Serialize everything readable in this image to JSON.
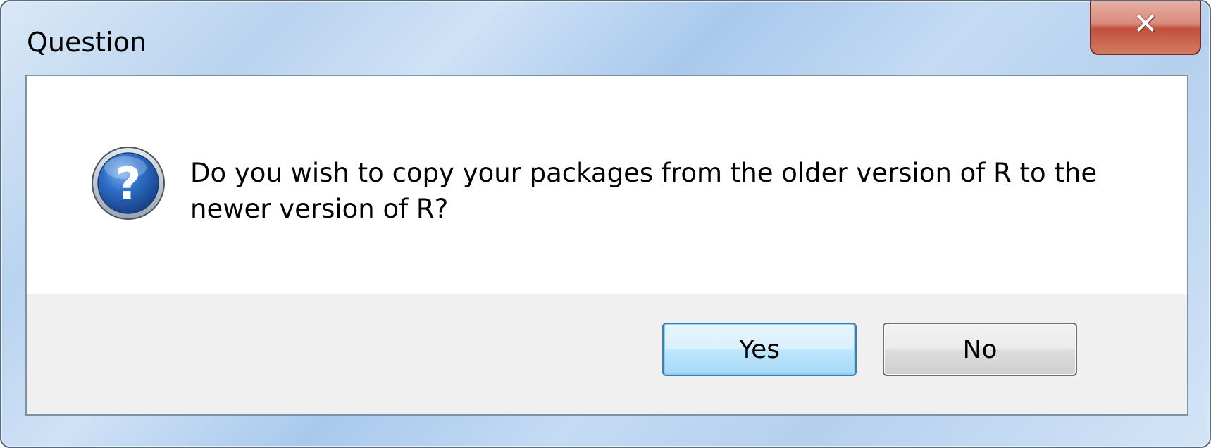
{
  "dialog": {
    "title": "Question",
    "message_line1": "Do you wish to copy your packages from the older version of R to the",
    "message_line2": "newer version of R?",
    "icon": "question-icon",
    "close_icon": "close-icon"
  },
  "buttons": {
    "yes_label": "Yes",
    "no_label": "No"
  },
  "colors": {
    "close_button": "#c2503c",
    "default_button_border": "#3c7fb1",
    "button_area": "#f0f0f0",
    "icon_blue": "#1f5fb5"
  }
}
